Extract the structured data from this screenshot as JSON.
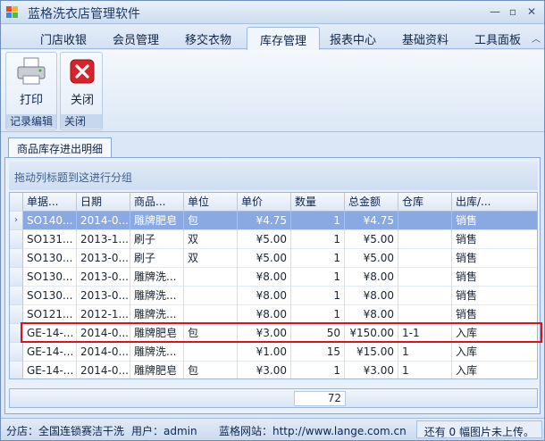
{
  "window": {
    "title": "蓝格洗衣店管理软件"
  },
  "menu": {
    "tabs": [
      "门店收银",
      "会员管理",
      "移交衣物",
      "库存管理",
      "报表中心",
      "基础资料",
      "工具面板"
    ],
    "active_index": 3
  },
  "ribbon": {
    "groups": [
      {
        "label": "记录编辑",
        "button": "打印"
      },
      {
        "label": "关闭",
        "button": "关闭"
      }
    ]
  },
  "document": {
    "tab": "商品库存进出明细",
    "group_hint": "拖动列标题到这进行分组"
  },
  "grid": {
    "columns": [
      "单据...",
      "日期",
      "商品...",
      "单位",
      "单价",
      "数量",
      "总金额",
      "仓库",
      "出库/..."
    ],
    "rows": [
      [
        "SO140...",
        "2014-0...",
        "雕牌肥皂",
        "包",
        "¥4.75",
        "1",
        "¥4.75",
        "",
        "销售"
      ],
      [
        "SO131...",
        "2013-1...",
        "刷子",
        "双",
        "¥5.00",
        "1",
        "¥5.00",
        "",
        "销售"
      ],
      [
        "SO130...",
        "2013-0...",
        "刷子",
        "双",
        "¥5.00",
        "1",
        "¥5.00",
        "",
        "销售"
      ],
      [
        "SO130...",
        "2013-0...",
        "雕牌洗...",
        "",
        "¥8.00",
        "1",
        "¥8.00",
        "",
        "销售"
      ],
      [
        "SO130...",
        "2013-0...",
        "雕牌洗...",
        "",
        "¥8.00",
        "1",
        "¥8.00",
        "",
        "销售"
      ],
      [
        "SO121...",
        "2012-1...",
        "雕牌洗...",
        "",
        "¥8.00",
        "1",
        "¥8.00",
        "",
        "销售"
      ],
      [
        "GE-14-...",
        "2014-0...",
        "雕牌肥皂",
        "包",
        "¥3.00",
        "50",
        "¥150.00",
        "1-1",
        "入库"
      ],
      [
        "GE-14-...",
        "2014-0...",
        "雕牌洗...",
        "",
        "¥1.00",
        "15",
        "¥15.00",
        "1",
        "入库"
      ],
      [
        "GE-14-...",
        "2014-0...",
        "雕牌肥皂",
        "包",
        "¥3.00",
        "1",
        "¥3.00",
        "1",
        "入库"
      ]
    ],
    "selected_row": 0,
    "quantity_total": "72"
  },
  "status": {
    "branch": "分店：全国连锁赛洁干洗",
    "user": "用户：admin",
    "site": "蓝格网站：http://www.lange.com.cn",
    "upload": "还有 0 幅图片未上传。"
  },
  "colors": {
    "highlight": "#e0111b",
    "selected_row": "#8aa8e2"
  }
}
